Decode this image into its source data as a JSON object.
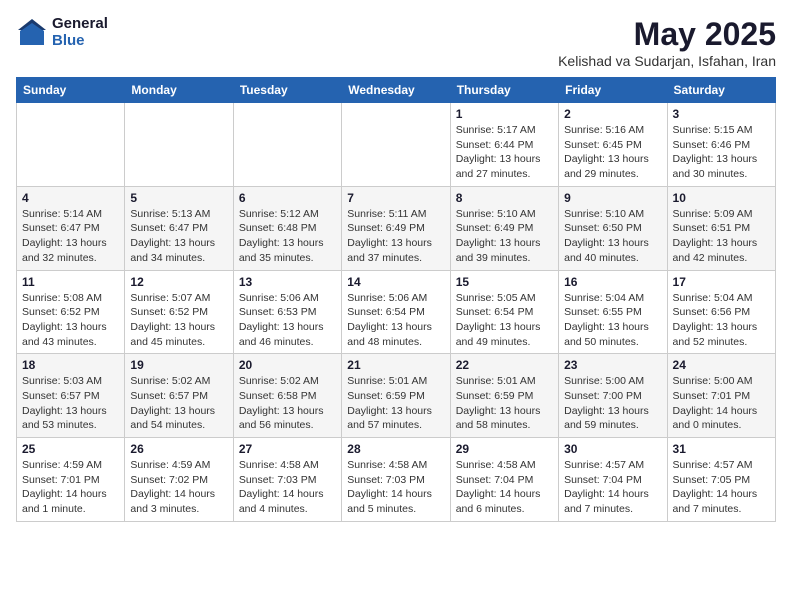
{
  "logo": {
    "general": "General",
    "blue": "Blue"
  },
  "title": "May 2025",
  "location": "Kelishad va Sudarjan, Isfahan, Iran",
  "days_of_week": [
    "Sunday",
    "Monday",
    "Tuesday",
    "Wednesday",
    "Thursday",
    "Friday",
    "Saturday"
  ],
  "weeks": [
    [
      {
        "day": "",
        "info": ""
      },
      {
        "day": "",
        "info": ""
      },
      {
        "day": "",
        "info": ""
      },
      {
        "day": "",
        "info": ""
      },
      {
        "day": "1",
        "info": "Sunrise: 5:17 AM\nSunset: 6:44 PM\nDaylight: 13 hours and 27 minutes."
      },
      {
        "day": "2",
        "info": "Sunrise: 5:16 AM\nSunset: 6:45 PM\nDaylight: 13 hours and 29 minutes."
      },
      {
        "day": "3",
        "info": "Sunrise: 5:15 AM\nSunset: 6:46 PM\nDaylight: 13 hours and 30 minutes."
      }
    ],
    [
      {
        "day": "4",
        "info": "Sunrise: 5:14 AM\nSunset: 6:47 PM\nDaylight: 13 hours and 32 minutes."
      },
      {
        "day": "5",
        "info": "Sunrise: 5:13 AM\nSunset: 6:47 PM\nDaylight: 13 hours and 34 minutes."
      },
      {
        "day": "6",
        "info": "Sunrise: 5:12 AM\nSunset: 6:48 PM\nDaylight: 13 hours and 35 minutes."
      },
      {
        "day": "7",
        "info": "Sunrise: 5:11 AM\nSunset: 6:49 PM\nDaylight: 13 hours and 37 minutes."
      },
      {
        "day": "8",
        "info": "Sunrise: 5:10 AM\nSunset: 6:49 PM\nDaylight: 13 hours and 39 minutes."
      },
      {
        "day": "9",
        "info": "Sunrise: 5:10 AM\nSunset: 6:50 PM\nDaylight: 13 hours and 40 minutes."
      },
      {
        "day": "10",
        "info": "Sunrise: 5:09 AM\nSunset: 6:51 PM\nDaylight: 13 hours and 42 minutes."
      }
    ],
    [
      {
        "day": "11",
        "info": "Sunrise: 5:08 AM\nSunset: 6:52 PM\nDaylight: 13 hours and 43 minutes."
      },
      {
        "day": "12",
        "info": "Sunrise: 5:07 AM\nSunset: 6:52 PM\nDaylight: 13 hours and 45 minutes."
      },
      {
        "day": "13",
        "info": "Sunrise: 5:06 AM\nSunset: 6:53 PM\nDaylight: 13 hours and 46 minutes."
      },
      {
        "day": "14",
        "info": "Sunrise: 5:06 AM\nSunset: 6:54 PM\nDaylight: 13 hours and 48 minutes."
      },
      {
        "day": "15",
        "info": "Sunrise: 5:05 AM\nSunset: 6:54 PM\nDaylight: 13 hours and 49 minutes."
      },
      {
        "day": "16",
        "info": "Sunrise: 5:04 AM\nSunset: 6:55 PM\nDaylight: 13 hours and 50 minutes."
      },
      {
        "day": "17",
        "info": "Sunrise: 5:04 AM\nSunset: 6:56 PM\nDaylight: 13 hours and 52 minutes."
      }
    ],
    [
      {
        "day": "18",
        "info": "Sunrise: 5:03 AM\nSunset: 6:57 PM\nDaylight: 13 hours and 53 minutes."
      },
      {
        "day": "19",
        "info": "Sunrise: 5:02 AM\nSunset: 6:57 PM\nDaylight: 13 hours and 54 minutes."
      },
      {
        "day": "20",
        "info": "Sunrise: 5:02 AM\nSunset: 6:58 PM\nDaylight: 13 hours and 56 minutes."
      },
      {
        "day": "21",
        "info": "Sunrise: 5:01 AM\nSunset: 6:59 PM\nDaylight: 13 hours and 57 minutes."
      },
      {
        "day": "22",
        "info": "Sunrise: 5:01 AM\nSunset: 6:59 PM\nDaylight: 13 hours and 58 minutes."
      },
      {
        "day": "23",
        "info": "Sunrise: 5:00 AM\nSunset: 7:00 PM\nDaylight: 13 hours and 59 minutes."
      },
      {
        "day": "24",
        "info": "Sunrise: 5:00 AM\nSunset: 7:01 PM\nDaylight: 14 hours and 0 minutes."
      }
    ],
    [
      {
        "day": "25",
        "info": "Sunrise: 4:59 AM\nSunset: 7:01 PM\nDaylight: 14 hours and 1 minute."
      },
      {
        "day": "26",
        "info": "Sunrise: 4:59 AM\nSunset: 7:02 PM\nDaylight: 14 hours and 3 minutes."
      },
      {
        "day": "27",
        "info": "Sunrise: 4:58 AM\nSunset: 7:03 PM\nDaylight: 14 hours and 4 minutes."
      },
      {
        "day": "28",
        "info": "Sunrise: 4:58 AM\nSunset: 7:03 PM\nDaylight: 14 hours and 5 minutes."
      },
      {
        "day": "29",
        "info": "Sunrise: 4:58 AM\nSunset: 7:04 PM\nDaylight: 14 hours and 6 minutes."
      },
      {
        "day": "30",
        "info": "Sunrise: 4:57 AM\nSunset: 7:04 PM\nDaylight: 14 hours and 7 minutes."
      },
      {
        "day": "31",
        "info": "Sunrise: 4:57 AM\nSunset: 7:05 PM\nDaylight: 14 hours and 7 minutes."
      }
    ]
  ]
}
